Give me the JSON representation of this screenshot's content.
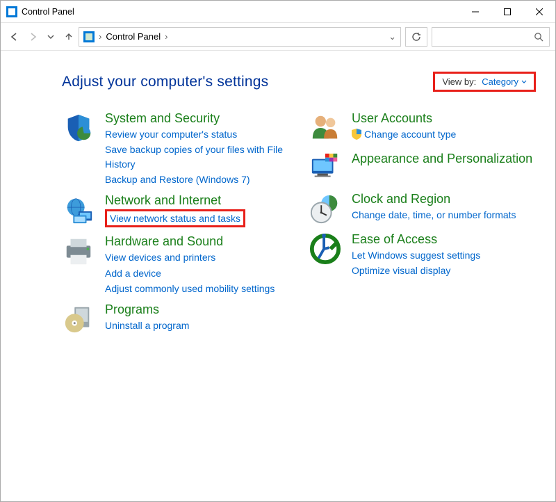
{
  "titlebar": {
    "title": "Control Panel"
  },
  "address": {
    "location": "Control Panel"
  },
  "settings_heading": "Adjust your computer's settings",
  "viewby": {
    "label": "View by:",
    "value": "Category"
  },
  "left": [
    {
      "title": "System and Security",
      "links": [
        "Review your computer's status",
        "Save backup copies of your files with File History",
        "Backup and Restore (Windows 7)"
      ]
    },
    {
      "title": "Network and Internet",
      "links": [
        "View network status and tasks"
      ]
    },
    {
      "title": "Hardware and Sound",
      "links": [
        "View devices and printers",
        "Add a device",
        "Adjust commonly used mobility settings"
      ]
    },
    {
      "title": "Programs",
      "links": [
        "Uninstall a program"
      ]
    }
  ],
  "right": [
    {
      "title": "User Accounts",
      "links": [
        "Change account type"
      ]
    },
    {
      "title": "Appearance and Personalization",
      "links": []
    },
    {
      "title": "Clock and Region",
      "links": [
        "Change date, time, or number formats"
      ]
    },
    {
      "title": "Ease of Access",
      "links": [
        "Let Windows suggest settings",
        "Optimize visual display"
      ]
    }
  ]
}
